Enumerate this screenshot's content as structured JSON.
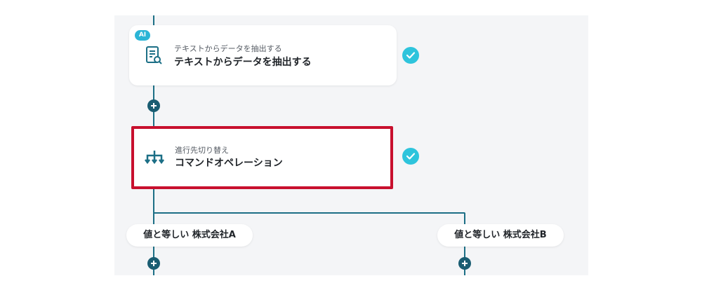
{
  "flow": {
    "ai_badge": "AI",
    "step_extract": {
      "subtitle": "テキストからデータを抽出する",
      "title": "テキストからデータを抽出する",
      "icon": "document-search-icon",
      "status": "completed"
    },
    "step_branch": {
      "subtitle": "進行先切り替え",
      "title": "コマンドオペレーション",
      "icon": "branch-icon",
      "status": "completed"
    },
    "branches": [
      {
        "label": "値と等しい 株式会社A"
      },
      {
        "label": "値と等しい 株式会社B"
      }
    ]
  },
  "colors": {
    "connector": "#1c6f86",
    "check": "#2ec4dc",
    "add_button": "#1a5d72",
    "highlight": "#c8102e",
    "ai_badge": "#2bb5d6"
  }
}
